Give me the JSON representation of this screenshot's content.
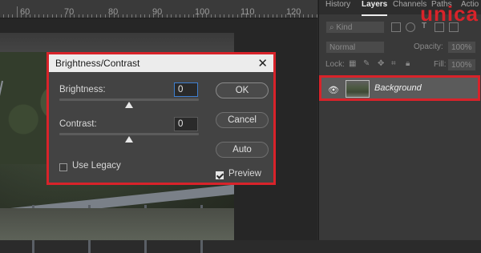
{
  "ruler": {
    "labels": [
      "60",
      "70",
      "80",
      "90",
      "100",
      "110",
      "120"
    ]
  },
  "dialog": {
    "title": "Brightness/Contrast",
    "brightness_label": "Brightness:",
    "brightness_value": "0",
    "contrast_label": "Contrast:",
    "contrast_value": "0",
    "brightness_slider_level": 0.5,
    "contrast_slider_level": 0.5,
    "use_legacy_label": "Use Legacy",
    "use_legacy_checked": false,
    "preview_label": "Preview",
    "preview_checked": true,
    "ok_label": "OK",
    "cancel_label": "Cancel",
    "auto_label": "Auto",
    "close_icon": "close-icon"
  },
  "panel": {
    "tabs": [
      "History",
      "Layers",
      "Channels",
      "Paths",
      "Actio"
    ],
    "active_tab": "Layers",
    "brand": "unica",
    "kind_filter": "Kind",
    "blend_mode": "Normal",
    "opacity_label": "Opacity:",
    "opacity_value": "100%",
    "lock_label": "Lock:",
    "fill_label": "Fill:",
    "fill_value": "100%",
    "layer_name": "Background",
    "visibility_icon": "eye-icon"
  },
  "colors": {
    "highlight_border": "#d8232a",
    "dialog_bg": "#434343",
    "panel_bg": "#393939",
    "focus_border": "#3f7fcf"
  }
}
